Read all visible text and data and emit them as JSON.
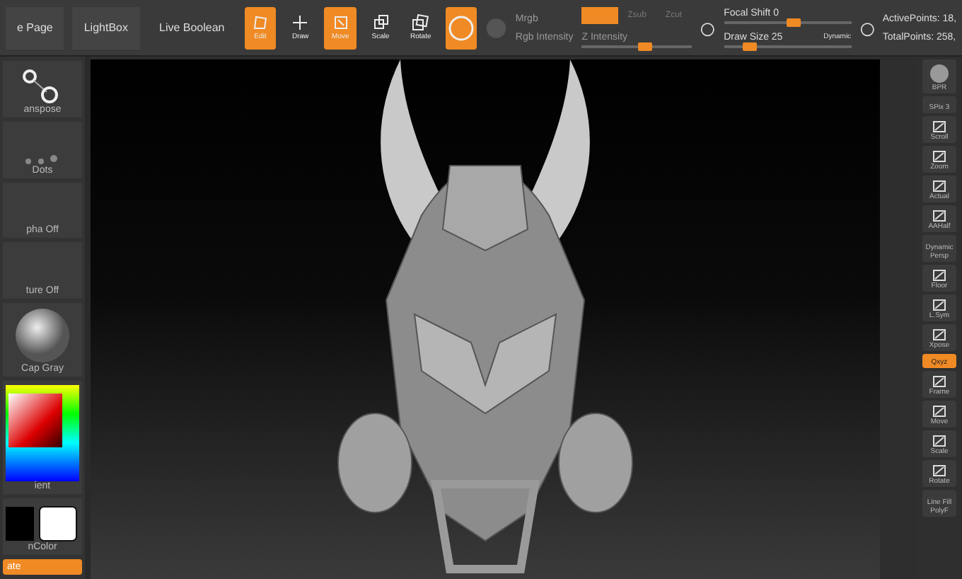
{
  "top_toolbar": {
    "buttons": [
      {
        "label": "e Page"
      },
      {
        "label": "LightBox"
      },
      {
        "label": "Live Boolean"
      }
    ],
    "tools": [
      {
        "kind": "edit",
        "label": "Edit",
        "selected": true
      },
      {
        "kind": "draw",
        "label": "Draw",
        "selected": false
      },
      {
        "kind": "move",
        "label": "Move",
        "selected": true
      },
      {
        "kind": "scale",
        "label": "Scale",
        "selected": false
      },
      {
        "kind": "rotate",
        "label": "Rotate",
        "selected": false
      },
      {
        "kind": "ring",
        "selected": true
      }
    ],
    "material": {
      "labels": [
        "Mrgb",
        "Rgb Intensity"
      ]
    },
    "zmodes": [
      {
        "selected": true
      },
      {
        "label": "Zsub",
        "selected": false
      },
      {
        "label": "Zcut",
        "selected": false
      }
    ],
    "sliders": [
      {
        "label": "Z Intensity",
        "level": 0.58
      },
      {
        "label": "Focal Shift 0",
        "level": 0.55
      },
      {
        "label": "Draw Size 25",
        "level": 0.17,
        "tag": "Dynamic"
      }
    ],
    "stats": [
      "ActivePoints: 18,",
      "TotalPoints: 258,"
    ]
  },
  "left_panel": [
    {
      "kind": "transpose",
      "label": "anspose"
    },
    {
      "kind": "dots",
      "label": "Dots"
    },
    {
      "kind": "blank",
      "label": "pha Off"
    },
    {
      "kind": "blank",
      "label": "ture Off"
    },
    {
      "kind": "sphere",
      "label": "Cap Gray"
    },
    {
      "kind": "picker",
      "label": "ient"
    },
    {
      "kind": "swatch",
      "label": "nColor"
    },
    {
      "kind": "button",
      "label": "ate"
    }
  ],
  "right_shelf": [
    {
      "kind": "sphere",
      "label": "BPR",
      "selected": false
    },
    {
      "kind": "slider",
      "label": "SPix 3",
      "selected": false
    },
    {
      "kind": "tool",
      "label": "Scroll",
      "selected": false
    },
    {
      "kind": "tool",
      "label": "Zoom",
      "selected": false
    },
    {
      "kind": "tool",
      "label": "Actual",
      "selected": false
    },
    {
      "kind": "tool",
      "label": "AAHalf",
      "selected": false
    },
    {
      "kind": "tool",
      "label": "Dynamic",
      "sub": "Persp",
      "selected": false
    },
    {
      "kind": "tool",
      "label": "Floor",
      "selected": false
    },
    {
      "kind": "tool",
      "label": "L.Sym",
      "selected": false
    },
    {
      "kind": "tool",
      "label": "Xpose",
      "selected": false
    },
    {
      "kind": "tag",
      "label": "Qxyz",
      "selected": true
    },
    {
      "kind": "tool",
      "label": "Frame",
      "selected": false
    },
    {
      "kind": "tool",
      "label": "Move",
      "selected": false
    },
    {
      "kind": "tool",
      "label": "Scale",
      "selected": false
    },
    {
      "kind": "tool",
      "label": "Rotate",
      "selected": false
    },
    {
      "kind": "tool",
      "label": "Line Fill",
      "sub": "PolyF",
      "selected": false
    }
  ]
}
